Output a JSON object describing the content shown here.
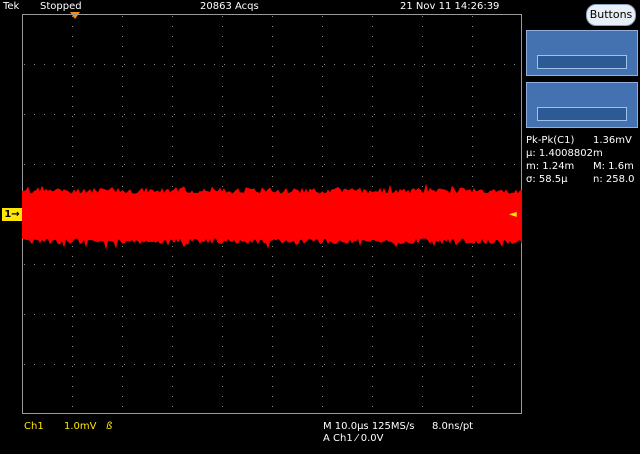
{
  "status": {
    "brand": "Tek",
    "run_state": "Stopped",
    "acqs": "20863 Acqs",
    "datetime": "21 Nov 11 14:26:39"
  },
  "buttons_label": "Buttons",
  "measurements": {
    "pkpk_label": "Pk-Pk(C1)",
    "pkpk_value": "1.36mV",
    "mean": "μ: 1.4008802m",
    "min": "m: 1.24m",
    "max": "M: 1.6m",
    "sigma": "σ: 58.5μ",
    "n": "n: 258.0"
  },
  "channel_marker": "1→",
  "footer": {
    "channel": "Ch1",
    "scale": "1.0mV",
    "bandwidth": "ß",
    "timebase": "M 10.0μs 125MS/s",
    "sample_interval": "8.0ns/pt",
    "trigger": "A  Ch1  ⁄  0.0V"
  },
  "colors": {
    "trace": "#ff0000",
    "channel": "#ffe600",
    "trigger_marker": "#ff8c00",
    "panel": "#4472b0"
  }
}
